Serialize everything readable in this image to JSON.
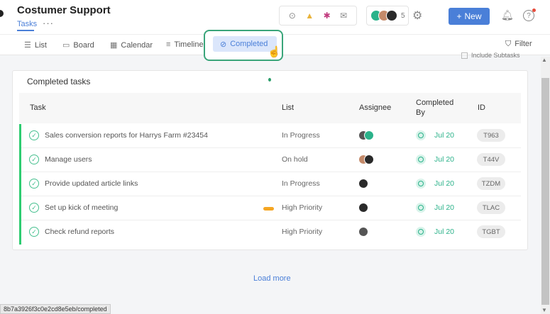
{
  "header": {
    "title": "Costumer Support",
    "tab": "Tasks",
    "more": "···",
    "avatar_count": "5",
    "new_button": "New",
    "new_plus": "+"
  },
  "integrations": [
    "⊙",
    "▲",
    "✱",
    "✉"
  ],
  "views": [
    {
      "icon": "☰",
      "label": "List"
    },
    {
      "icon": "▭",
      "label": "Board"
    },
    {
      "icon": "▦",
      "label": "Calendar"
    },
    {
      "icon": "≡",
      "label": "Timeline"
    },
    {
      "icon": "⊘",
      "label": "Completed"
    }
  ],
  "filter": "Filter",
  "include_subtasks": "Include Subtasks",
  "card": {
    "title": "Completed tasks",
    "columns": {
      "task": "Task",
      "list": "List",
      "assignee": "Assignee",
      "completed_by_1": "Completed",
      "completed_by_2": "By",
      "id": "ID"
    },
    "rows": [
      {
        "task": "Sales conversion reports for Harrys Farm #23454",
        "list": "In Progress",
        "date": "Jul 20",
        "id": "T963"
      },
      {
        "task": "Manage users",
        "list": "On hold",
        "date": "Jul 20",
        "id": "T44V"
      },
      {
        "task": "Provide updated article links",
        "list": "In Progress",
        "date": "Jul 20",
        "id": "TZDM"
      },
      {
        "task": "Set up kick of meeting",
        "list": "High Priority",
        "date": "Jul 20",
        "id": "TLAC"
      },
      {
        "task": "Check refund reports",
        "list": "High Priority",
        "date": "Jul 20",
        "id": "TGBT"
      }
    ]
  },
  "load_more": "Load more",
  "status_url": "8b7a3926f3c0e2cd8e5eb/completed",
  "colors": {
    "accent": "#4a7fd8",
    "green": "#2ecc71",
    "highlight": "#3aa57a"
  }
}
